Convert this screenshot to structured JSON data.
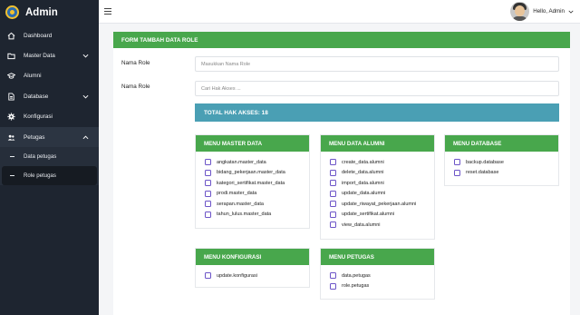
{
  "brand": {
    "name": "Admin"
  },
  "sidebar": {
    "items": [
      {
        "label": "Dashboard",
        "icon": "home-icon"
      },
      {
        "label": "Master Data",
        "icon": "folder-icon"
      },
      {
        "label": "Alumni",
        "icon": "graduation-cap-icon"
      },
      {
        "label": "Database",
        "icon": "file-icon"
      },
      {
        "label": "Konfigurasi",
        "icon": "gear-icon"
      },
      {
        "label": "Petugas",
        "icon": "users-icon"
      }
    ],
    "subitems": [
      {
        "label": "Data petugas"
      },
      {
        "label": "Role petugas"
      }
    ]
  },
  "topbar": {
    "greeting": "Hello, Admin"
  },
  "form": {
    "title": "FORM TAMBAH DATA ROLE",
    "role_label": "Nama Role",
    "role_placeholder": "Masukkan Nama Role",
    "access_label": "Nama Role",
    "access_placeholder": "Cari Hak Akses ...",
    "total": "TOTAL HAK AKSES: 18"
  },
  "groups": {
    "master": {
      "title": "MENU MASTER DATA",
      "perms": [
        "angkatan.master_data",
        "bidang_pekerjaan.master_data",
        "kategori_sertifikat.master_data",
        "prodi.master_data",
        "serapan.master_data",
        "tahun_lulus.master_data"
      ]
    },
    "alumni": {
      "title": "MENU DATA ALUMNI",
      "perms": [
        "create_data.alumni",
        "delete_data.alumni",
        "import_data.alumni",
        "update_data.alumni",
        "update_riwayat_pekerjaan.alumni",
        "update_sertifikat.alumni",
        "view_data.alumni"
      ]
    },
    "database": {
      "title": "MENU DATABASE",
      "perms": [
        "backup.database",
        "reset.database"
      ]
    },
    "konfigurasi": {
      "title": "MENU KONFIGURASI",
      "perms": [
        "update.konfigurasi"
      ]
    },
    "petugas": {
      "title": "MENU PETUGAS",
      "perms": [
        "data.petugas",
        "role.petugas"
      ]
    }
  },
  "colors": {
    "green": "#48a74c",
    "teal": "#4a9fb4",
    "sidebar": "#1e2530",
    "checkbox": "#6b53c7"
  }
}
